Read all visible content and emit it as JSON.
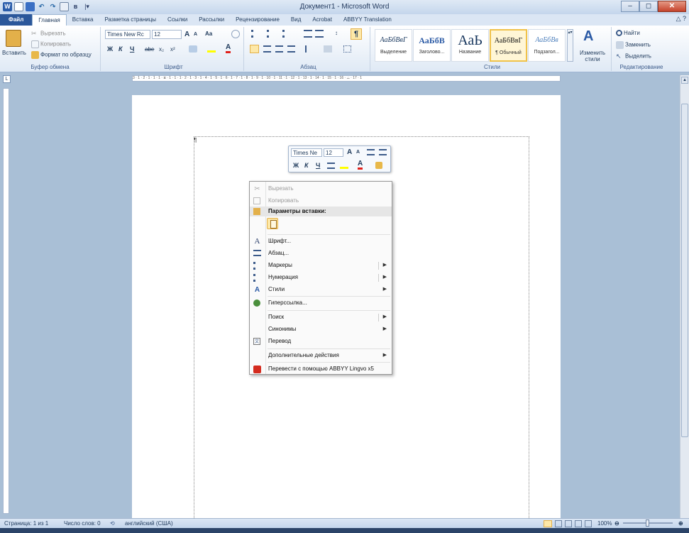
{
  "window": {
    "title": "Документ1 - Microsoft Word",
    "minimize": "–",
    "maximize": "◻",
    "close": "✕"
  },
  "qat": {
    "logo": "W",
    "icons": [
      "save-icon",
      "undo-icon",
      "redo-icon",
      "print-preview-icon",
      "spelling-icon",
      "customize-qat-icon"
    ]
  },
  "tabs": [
    "Файл",
    "Главная",
    "Вставка",
    "Разметка страницы",
    "Ссылки",
    "Рассылки",
    "Рецензирование",
    "Вид",
    "Acrobat",
    "ABBYY Translation"
  ],
  "help_glyph": "△ ?",
  "clipboard": {
    "paste": "Вставить",
    "cut": "Вырезать",
    "copy": "Копировать",
    "format_painter": "Формат по образцу",
    "label": "Буфер обмена"
  },
  "font": {
    "name": "Times New Rc",
    "size": "12",
    "grow": "A",
    "shrink": "A",
    "case": "Aa",
    "bold": "Ж",
    "italic": "К",
    "underline": "Ч",
    "strike": "abe",
    "sub": "x₂",
    "sup": "x²",
    "label": "Шрифт"
  },
  "paragraph": {
    "label": "Абзац",
    "pilcrow": "¶"
  },
  "styles": {
    "label": "Стили",
    "items": [
      {
        "sample": "АаБбВвГ",
        "name": "Выделение"
      },
      {
        "sample": "АаБбВ",
        "name": "Заголово..."
      },
      {
        "sample": "АаЬ",
        "name": "Название"
      },
      {
        "sample": "АаБбВвГ",
        "name": "¶ Обычный"
      },
      {
        "sample": "АаБбВв",
        "name": "Подзагол..."
      }
    ],
    "change": "Изменить стили"
  },
  "editing": {
    "find": "Найти",
    "replace": "Заменить",
    "select": "Выделить",
    "label": "Редактирование"
  },
  "ruler": {
    "marks": "3 · 1 · 2 · 1 · 1 · 1 · ⧖ · 1 · 1 · 1 · 2 · 1 · 3 · 1 · 4 · 1 · 5 · 1 · 6 · 1 · 7 · 1 · 8 · 1 · 9 · 1 · 10 · 1 · 11 · 1 · 12 · 1 · 13 · 1 · 14 · 1 · 15 · 1 · 16 · △ · 17 · 1",
    "corner": "L"
  },
  "document": {
    "pilcrow": "¶"
  },
  "mini_toolbar": {
    "font": "Times Ne",
    "size": "12",
    "grow": "A",
    "shrink": "A",
    "bold": "Ж",
    "italic": "К",
    "underline": "Ч"
  },
  "context_menu": {
    "cut": "Вырезать",
    "copy": "Копировать",
    "paste_options": "Параметры вставки:",
    "font": "Шрифт...",
    "paragraph": "Абзац...",
    "bullets": "Маркеры",
    "numbering": "Нумерация",
    "styles": "Стили",
    "hyperlink": "Гиперссылка...",
    "search": "Поиск",
    "synonyms": "Синонимы",
    "translate": "Перевод",
    "more_actions": "Дополнительные действия",
    "lingvo": "Перевести с помощью ABBYY Lingvo x5"
  },
  "status": {
    "page": "Страница: 1 из 1",
    "words": "Число слов: 0",
    "language": "английский (США)",
    "zoom": "100%",
    "zoom_level": 1.0
  }
}
